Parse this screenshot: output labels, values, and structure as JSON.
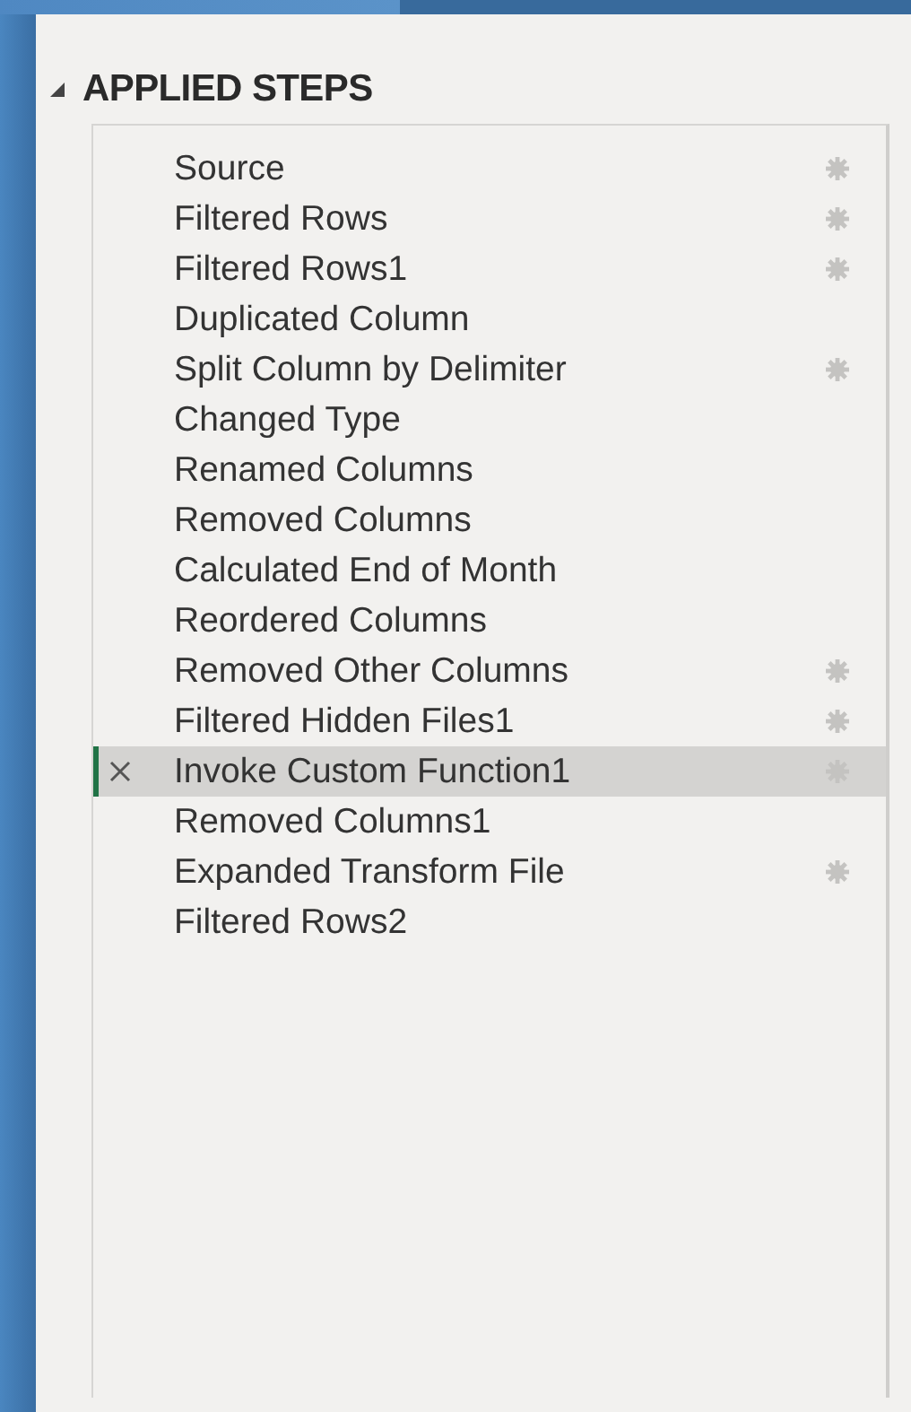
{
  "section": {
    "title": "APPLIED STEPS",
    "expanded": true
  },
  "steps": [
    {
      "label": "Source",
      "selected": false,
      "has_settings": true
    },
    {
      "label": "Filtered Rows",
      "selected": false,
      "has_settings": true
    },
    {
      "label": "Filtered Rows1",
      "selected": false,
      "has_settings": true
    },
    {
      "label": "Duplicated Column",
      "selected": false,
      "has_settings": false
    },
    {
      "label": "Split Column by Delimiter",
      "selected": false,
      "has_settings": true
    },
    {
      "label": "Changed Type",
      "selected": false,
      "has_settings": false
    },
    {
      "label": "Renamed Columns",
      "selected": false,
      "has_settings": false
    },
    {
      "label": "Removed Columns",
      "selected": false,
      "has_settings": false
    },
    {
      "label": "Calculated End of Month",
      "selected": false,
      "has_settings": false
    },
    {
      "label": "Reordered Columns",
      "selected": false,
      "has_settings": false
    },
    {
      "label": "Removed Other Columns",
      "selected": false,
      "has_settings": true
    },
    {
      "label": "Filtered Hidden Files1",
      "selected": false,
      "has_settings": true
    },
    {
      "label": "Invoke Custom Function1",
      "selected": true,
      "has_settings": true
    },
    {
      "label": "Removed Columns1",
      "selected": false,
      "has_settings": false
    },
    {
      "label": "Expanded Transform File",
      "selected": false,
      "has_settings": true
    },
    {
      "label": "Filtered Rows2",
      "selected": false,
      "has_settings": false
    }
  ]
}
